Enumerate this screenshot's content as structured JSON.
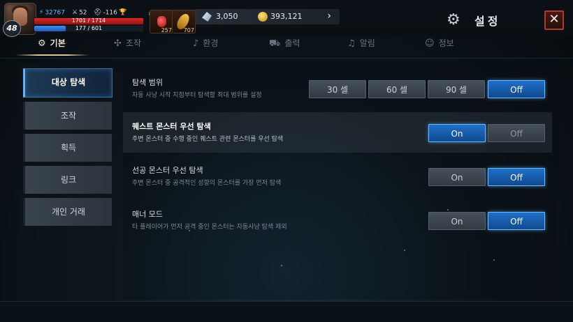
{
  "player": {
    "level": "48",
    "power": "32767",
    "stat_a": "52",
    "stat_b": "-116",
    "hp": "1701 / 1714",
    "mp": "177 / 601",
    "mp_fraction": 0.29
  },
  "quick_slots": [
    {
      "icon": "potion-icon",
      "count": "257"
    },
    {
      "icon": "feather-icon",
      "count": "707"
    }
  ],
  "currency": {
    "gems": "3,050",
    "gold": "393,121"
  },
  "header": {
    "title": "설정"
  },
  "tabs": [
    {
      "label": "기본",
      "icon": "gear-icon",
      "active": true
    },
    {
      "label": "조작",
      "icon": "dpad-icon",
      "active": false
    },
    {
      "label": "환경",
      "icon": "music-note-icon",
      "active": false
    },
    {
      "label": "출력",
      "icon": "cart-icon",
      "active": false
    },
    {
      "label": "알림",
      "icon": "bell-icon",
      "active": false
    },
    {
      "label": "정보",
      "icon": "person-icon",
      "active": false
    }
  ],
  "sidebar": {
    "items": [
      {
        "label": "대상 탐색",
        "active": true
      },
      {
        "label": "조작",
        "active": false
      },
      {
        "label": "획득",
        "active": false
      },
      {
        "label": "링크",
        "active": false
      },
      {
        "label": "개인 거래",
        "active": false
      }
    ]
  },
  "settings": [
    {
      "title": "탐색 범위",
      "description": "자동 사냥 시작 지점부터 탐색할 최대 범위를 설정",
      "options": [
        "30 셀",
        "60 셀",
        "90 셀",
        "Off"
      ],
      "selected": "Off"
    },
    {
      "title": "퀘스트 몬스터 우선 탐색",
      "description": "주변 몬스터 중 수행 중인 퀘스트 관련 몬스터를 우선 탐색",
      "options": [
        "On",
        "Off"
      ],
      "selected": "On"
    },
    {
      "title": "선공 몬스터 우선 탐색",
      "description": "주변 몬스터 중 공격적인 성향의 몬스터를 가장 먼저 탐색",
      "options": [
        "On",
        "Off"
      ],
      "selected": "Off"
    },
    {
      "title": "매너 모드",
      "description": "타 플레이어가 먼저 공격 중인 몬스터는 자동사냥 탐색 제외",
      "options": [
        "On",
        "Off"
      ],
      "selected": "Off"
    }
  ],
  "colors": {
    "accent_blue": "#1f6fc9",
    "hp_red": "#d62b2b",
    "close_red": "#b13b2b",
    "tab_gold": "#d7c49a"
  }
}
